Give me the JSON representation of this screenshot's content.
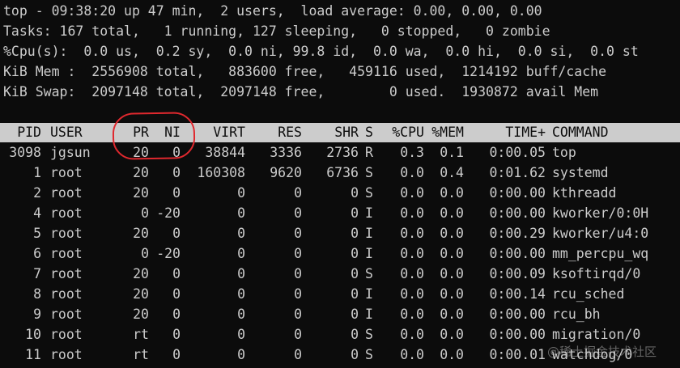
{
  "summary": [
    "top - 09:38:20 up 47 min,  2 users,  load average: 0.00, 0.00, 0.00",
    "Tasks: 167 total,   1 running, 127 sleeping,   0 stopped,   0 zombie",
    "%Cpu(s):  0.0 us,  0.2 sy,  0.0 ni, 99.8 id,  0.0 wa,  0.0 hi,  0.0 si,  0.0 st",
    "KiB Mem :  2556908 total,   883600 free,   459116 used,  1214192 buff/cache",
    "KiB Swap:  2097148 total,  2097148 free,        0 used.  1930872 avail Mem"
  ],
  "columns": {
    "pid": "PID",
    "user": "USER",
    "pr": "PR",
    "ni": "NI",
    "virt": "VIRT",
    "res": "RES",
    "shr": "SHR",
    "s": "S",
    "cpu": "%CPU",
    "mem": "%MEM",
    "time": "TIME+",
    "command": "COMMAND"
  },
  "processes": [
    {
      "pid": "3098",
      "user": "jgsun",
      "pr": "20",
      "ni": "0",
      "virt": "38844",
      "res": "3336",
      "shr": "2736",
      "s": "R",
      "cpu": "0.3",
      "mem": "0.1",
      "time": "0:00.05",
      "command": "top"
    },
    {
      "pid": "1",
      "user": "root",
      "pr": "20",
      "ni": "0",
      "virt": "160308",
      "res": "9620",
      "shr": "6736",
      "s": "S",
      "cpu": "0.0",
      "mem": "0.4",
      "time": "0:01.62",
      "command": "systemd"
    },
    {
      "pid": "2",
      "user": "root",
      "pr": "20",
      "ni": "0",
      "virt": "0",
      "res": "0",
      "shr": "0",
      "s": "S",
      "cpu": "0.0",
      "mem": "0.0",
      "time": "0:00.00",
      "command": "kthreadd"
    },
    {
      "pid": "4",
      "user": "root",
      "pr": "0",
      "ni": "-20",
      "virt": "0",
      "res": "0",
      "shr": "0",
      "s": "I",
      "cpu": "0.0",
      "mem": "0.0",
      "time": "0:00.00",
      "command": "kworker/0:0H"
    },
    {
      "pid": "5",
      "user": "root",
      "pr": "20",
      "ni": "0",
      "virt": "0",
      "res": "0",
      "shr": "0",
      "s": "I",
      "cpu": "0.0",
      "mem": "0.0",
      "time": "0:00.29",
      "command": "kworker/u4:0"
    },
    {
      "pid": "6",
      "user": "root",
      "pr": "0",
      "ni": "-20",
      "virt": "0",
      "res": "0",
      "shr": "0",
      "s": "I",
      "cpu": "0.0",
      "mem": "0.0",
      "time": "0:00.00",
      "command": "mm_percpu_wq"
    },
    {
      "pid": "7",
      "user": "root",
      "pr": "20",
      "ni": "0",
      "virt": "0",
      "res": "0",
      "shr": "0",
      "s": "S",
      "cpu": "0.0",
      "mem": "0.0",
      "time": "0:00.09",
      "command": "ksoftirqd/0"
    },
    {
      "pid": "8",
      "user": "root",
      "pr": "20",
      "ni": "0",
      "virt": "0",
      "res": "0",
      "shr": "0",
      "s": "I",
      "cpu": "0.0",
      "mem": "0.0",
      "time": "0:00.14",
      "command": "rcu_sched"
    },
    {
      "pid": "9",
      "user": "root",
      "pr": "20",
      "ni": "0",
      "virt": "0",
      "res": "0",
      "shr": "0",
      "s": "I",
      "cpu": "0.0",
      "mem": "0.0",
      "time": "0:00.00",
      "command": "rcu_bh"
    },
    {
      "pid": "10",
      "user": "root",
      "pr": "rt",
      "ni": "0",
      "virt": "0",
      "res": "0",
      "shr": "0",
      "s": "S",
      "cpu": "0.0",
      "mem": "0.0",
      "time": "0:00.00",
      "command": "migration/0"
    },
    {
      "pid": "11",
      "user": "root",
      "pr": "rt",
      "ni": "0",
      "virt": "0",
      "res": "0",
      "shr": "0",
      "s": "S",
      "cpu": "0.0",
      "mem": "0.0",
      "time": "0:00.01",
      "command": "watchdog/0"
    }
  ],
  "annotation": {
    "color": "#e0282e",
    "target": "PR and NI columns"
  },
  "watermark": "@稀土掘金技术社区",
  "colors": {
    "background": "#0c0c0c",
    "foreground": "#cccccc",
    "header_bg": "#cccccc",
    "header_fg": "#0c0c0c"
  }
}
